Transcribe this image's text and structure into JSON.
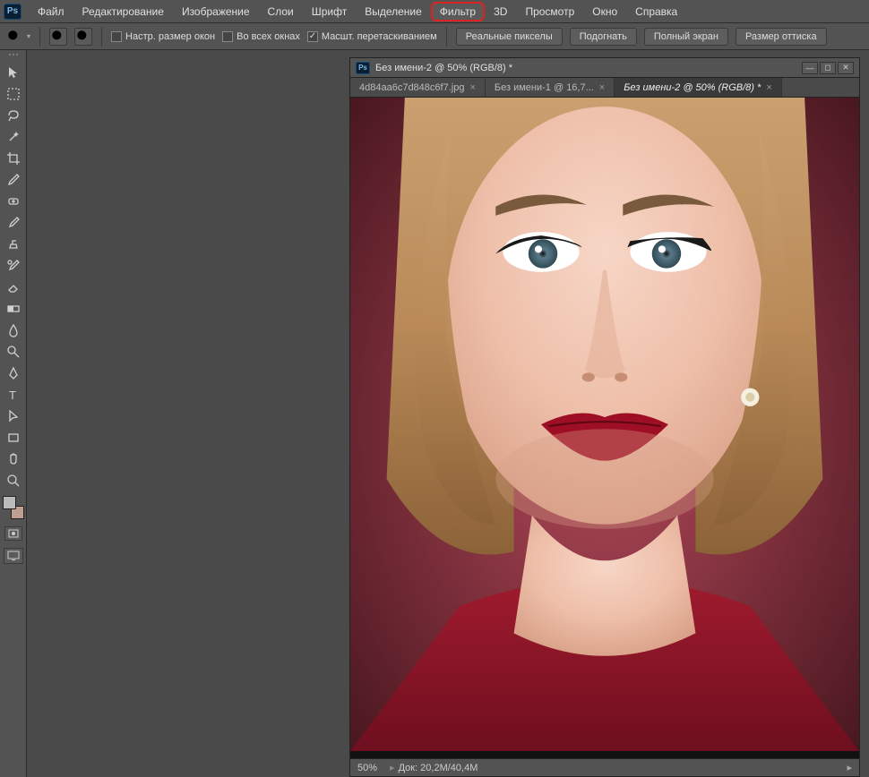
{
  "app": {
    "logo": "Ps"
  },
  "menu": {
    "items": [
      {
        "label": "Файл",
        "highlighted": false
      },
      {
        "label": "Редактирование",
        "highlighted": false
      },
      {
        "label": "Изображение",
        "highlighted": false
      },
      {
        "label": "Слои",
        "highlighted": false
      },
      {
        "label": "Шрифт",
        "highlighted": false
      },
      {
        "label": "Выделение",
        "highlighted": false
      },
      {
        "label": "Фильтр",
        "highlighted": true
      },
      {
        "label": "3D",
        "highlighted": false
      },
      {
        "label": "Просмотр",
        "highlighted": false
      },
      {
        "label": "Окно",
        "highlighted": false
      },
      {
        "label": "Справка",
        "highlighted": false
      }
    ]
  },
  "options": {
    "resize_windows": "Настр. размер окон",
    "all_windows": "Во всех окнах",
    "scrubby_zoom": "Масшт. перетаскиванием",
    "scrubby_checked": true,
    "buttons": {
      "actual_pixels": "Реальные пикселы",
      "fit_screen": "Подогнать",
      "full_screen": "Полный экран",
      "print_size": "Размер оттиска"
    }
  },
  "tools": [
    "move",
    "marquee",
    "lasso",
    "magic-wand",
    "crop",
    "eyedropper",
    "healing-brush",
    "brush",
    "clone-stamp",
    "history-brush",
    "eraser",
    "gradient",
    "blur",
    "dodge",
    "pen",
    "type",
    "path-selection",
    "rectangle",
    "hand",
    "zoom"
  ],
  "swatches": {
    "fg": "#bbbbbb",
    "bg": "#bfa090"
  },
  "document": {
    "title": "Без имени-2 @ 50% (RGB/8) *",
    "tabs": [
      {
        "label": "4d84aa6c7d848c6f7.jpg",
        "active": false
      },
      {
        "label": "Без имени-1 @ 16,7...",
        "active": false
      },
      {
        "label": "Без имени-2 @ 50% (RGB/8) *",
        "active": true
      }
    ]
  },
  "status": {
    "zoom": "50%",
    "doc_size": "Док: 20,2M/40,4M"
  }
}
